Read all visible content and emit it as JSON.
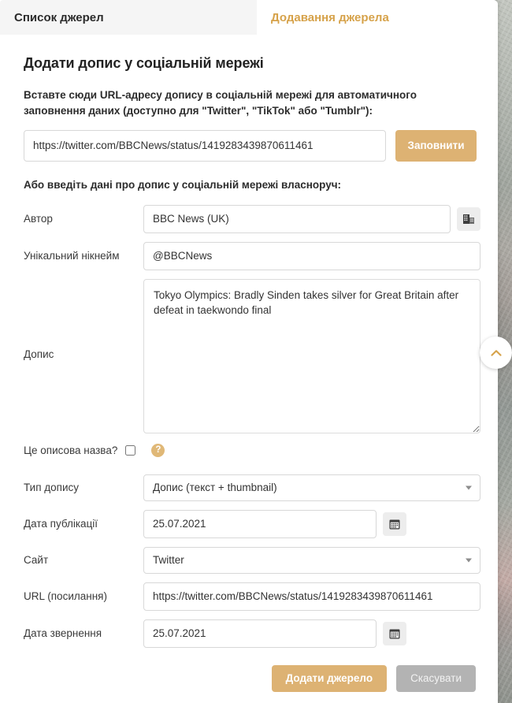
{
  "tabs": [
    {
      "label": "Список джерел",
      "active": false
    },
    {
      "label": "Додавання джерела",
      "active": true
    }
  ],
  "page_title": "Додати допис у соціальній мережі",
  "auto_fill": {
    "instructions": "Вставте сюди URL-адресу допису в соціальній мережі для автоматичного заповнення даних (доступно для \"Twitter\", \"TikTok\" або \"Tumblr\"):",
    "url_value": "https://twitter.com/BBCNews/status/1419283439870611461",
    "url_placeholder": "",
    "fill_button": "Заповнити"
  },
  "manual": {
    "subheading": "Або введіть дані про допис у соціальній мережі власноруч:",
    "author": {
      "label": "Автор",
      "value": "BBC News (UK)",
      "icon": "building-icon"
    },
    "nickname": {
      "label": "Унікальний нікнейм",
      "value": "@BBCNews"
    },
    "post": {
      "label": "Допис",
      "value": "Tokyo Olympics: Bradly Sinden takes silver for Great Britain after defeat in taekwondo final"
    },
    "descriptive": {
      "label": "Це описова назва?",
      "checked": false,
      "help": "?"
    },
    "post_type": {
      "label": "Тип допису",
      "value": "Допис (текст + thumbnail)",
      "options": [
        "Допис (текст + thumbnail)"
      ]
    },
    "publish_date": {
      "label": "Дата публікації",
      "value": "25.07.2021",
      "icon": "calendar-icon"
    },
    "site": {
      "label": "Сайт",
      "value": "Twitter",
      "options": [
        "Twitter"
      ]
    },
    "url": {
      "label": "URL (посилання)",
      "value": "https://twitter.com/BBCNews/status/1419283439870611461"
    },
    "access_date": {
      "label": "Дата звернення",
      "value": "25.07.2021",
      "icon": "calendar-icon"
    }
  },
  "actions": {
    "submit": "Додати джерело",
    "cancel": "Скасувати"
  },
  "floating": {
    "scroll_top_icon": "chevron-up-icon"
  },
  "colors": {
    "accent": "#d6a24a",
    "button": "#ddb273",
    "cancel": "#b3b3b3",
    "tab_inactive_bg": "#f5f5f5"
  }
}
